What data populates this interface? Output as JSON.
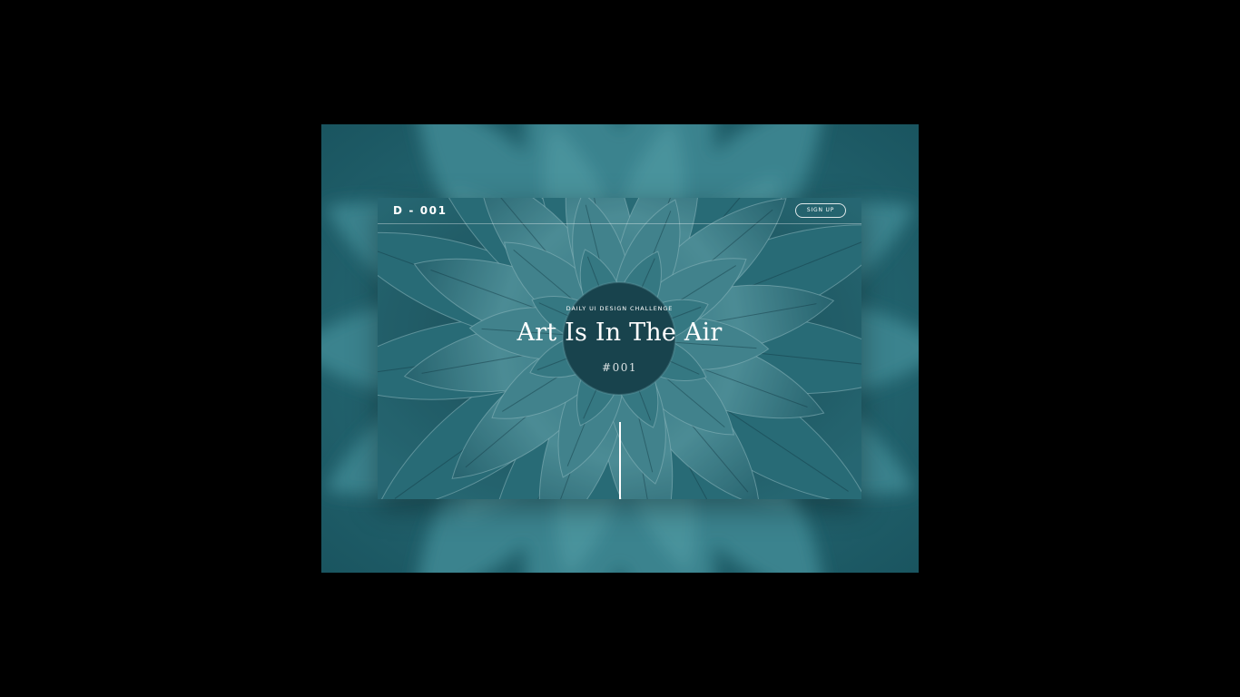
{
  "nav": {
    "brand": "D - 001",
    "signup_label": "SIGN UP"
  },
  "hero": {
    "eyebrow": "DAILY UI DESIGN CHALLENGE",
    "title": "Art Is In The Air",
    "number": "#001"
  },
  "icons": [
    "succulent-photo",
    "scroll-indicator"
  ],
  "colors": {
    "page_background": "#000000",
    "teal_dark": "#1f5f6a",
    "teal_mid": "#2c7580",
    "teal_light": "#4f9aa3",
    "text": "#ffffff"
  }
}
